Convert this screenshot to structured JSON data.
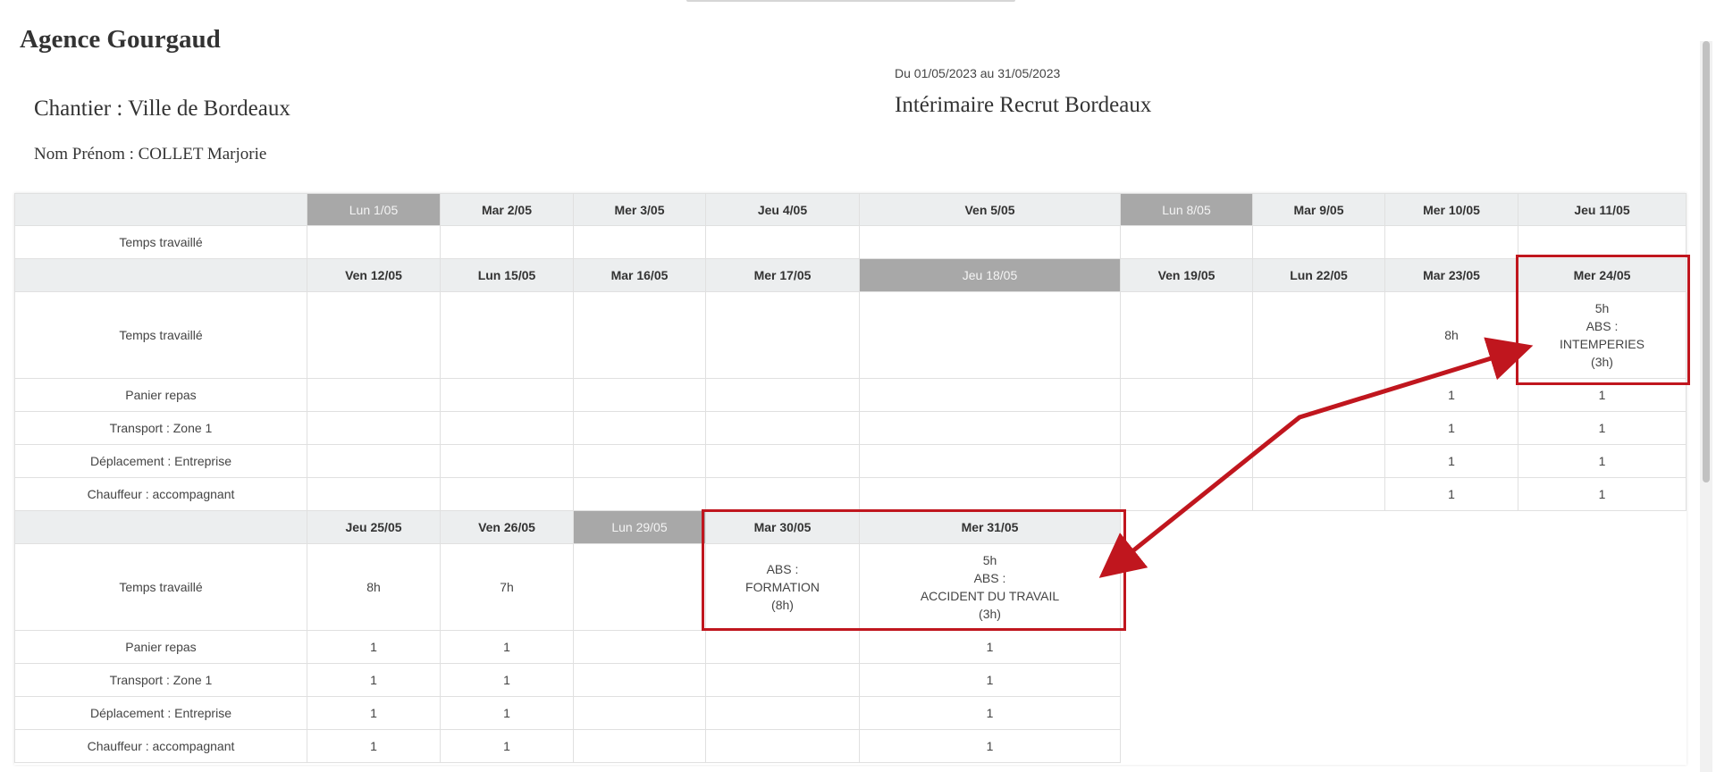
{
  "header": {
    "agency": "Agence Gourgaud",
    "chantier": "Chantier : Ville de Bordeaux",
    "person": "Nom Prénom : COLLET Marjorie",
    "period": "Du 01/05/2023 au 31/05/2023",
    "agency_secondary": "Intérimaire Recrut Bordeaux"
  },
  "labels": {
    "temps": "Temps travaillé",
    "panier": "Panier repas",
    "transport": "Transport : Zone 1",
    "deplacement": "Déplacement : Entreprise",
    "chauffeur": "Chauffeur : accompagnant"
  },
  "weeks": [
    {
      "days": [
        {
          "label": "Lun 1/05",
          "off": true,
          "temps": ""
        },
        {
          "label": "Mar 2/05",
          "off": false,
          "temps": ""
        },
        {
          "label": "Mer 3/05",
          "off": false,
          "temps": ""
        },
        {
          "label": "Jeu 4/05",
          "off": false,
          "temps": ""
        },
        {
          "label": "Ven 5/05",
          "off": false,
          "temps": ""
        },
        {
          "label": "Lun 8/05",
          "off": true,
          "temps": ""
        },
        {
          "label": "Mar 9/05",
          "off": false,
          "temps": ""
        },
        {
          "label": "Mer 10/05",
          "off": false,
          "temps": ""
        },
        {
          "label": "Jeu 11/05",
          "off": false,
          "temps": ""
        }
      ]
    },
    {
      "days": [
        {
          "label": "Ven 12/05",
          "off": false,
          "temps": "",
          "panier": "",
          "transport": "",
          "deplacement": "",
          "chauffeur": ""
        },
        {
          "label": "Lun 15/05",
          "off": false,
          "temps": "",
          "panier": "",
          "transport": "",
          "deplacement": "",
          "chauffeur": ""
        },
        {
          "label": "Mar 16/05",
          "off": false,
          "temps": "",
          "panier": "",
          "transport": "",
          "deplacement": "",
          "chauffeur": ""
        },
        {
          "label": "Mer 17/05",
          "off": false,
          "temps": "",
          "panier": "",
          "transport": "",
          "deplacement": "",
          "chauffeur": ""
        },
        {
          "label": "Jeu 18/05",
          "off": true,
          "temps": "",
          "panier": "",
          "transport": "",
          "deplacement": "",
          "chauffeur": ""
        },
        {
          "label": "Ven 19/05",
          "off": false,
          "temps": "",
          "panier": "",
          "transport": "",
          "deplacement": "",
          "chauffeur": ""
        },
        {
          "label": "Lun 22/05",
          "off": false,
          "temps": "",
          "panier": "",
          "transport": "",
          "deplacement": "",
          "chauffeur": ""
        },
        {
          "label": "Mar 23/05",
          "off": false,
          "temps": "8h",
          "panier": "1",
          "transport": "1",
          "deplacement": "1",
          "chauffeur": "1"
        },
        {
          "label": "Mer 24/05",
          "off": false,
          "temps": "5h\nABS :\nINTEMPERIES\n(3h)",
          "panier": "1",
          "transport": "1",
          "deplacement": "1",
          "chauffeur": "1"
        }
      ]
    },
    {
      "days": [
        {
          "label": "Jeu 25/05",
          "off": false,
          "temps": "8h",
          "panier": "1",
          "transport": "1",
          "deplacement": "1",
          "chauffeur": "1"
        },
        {
          "label": "Ven 26/05",
          "off": false,
          "temps": "7h",
          "panier": "1",
          "transport": "1",
          "deplacement": "1",
          "chauffeur": "1"
        },
        {
          "label": "Lun 29/05",
          "off": true,
          "temps": "",
          "panier": "",
          "transport": "",
          "deplacement": "",
          "chauffeur": ""
        },
        {
          "label": "Mar 30/05",
          "off": false,
          "temps": "ABS :\nFORMATION\n(8h)",
          "panier": "",
          "transport": "",
          "deplacement": "",
          "chauffeur": ""
        },
        {
          "label": "Mer 31/05",
          "off": false,
          "temps": "5h\nABS :\nACCIDENT DU TRAVAIL\n(3h)",
          "panier": "1",
          "transport": "1",
          "deplacement": "1",
          "chauffeur": "1"
        }
      ]
    }
  ],
  "colors": {
    "highlight": "#c0161e",
    "header_bg": "#eceeef",
    "off_bg": "#a8a8a8"
  }
}
